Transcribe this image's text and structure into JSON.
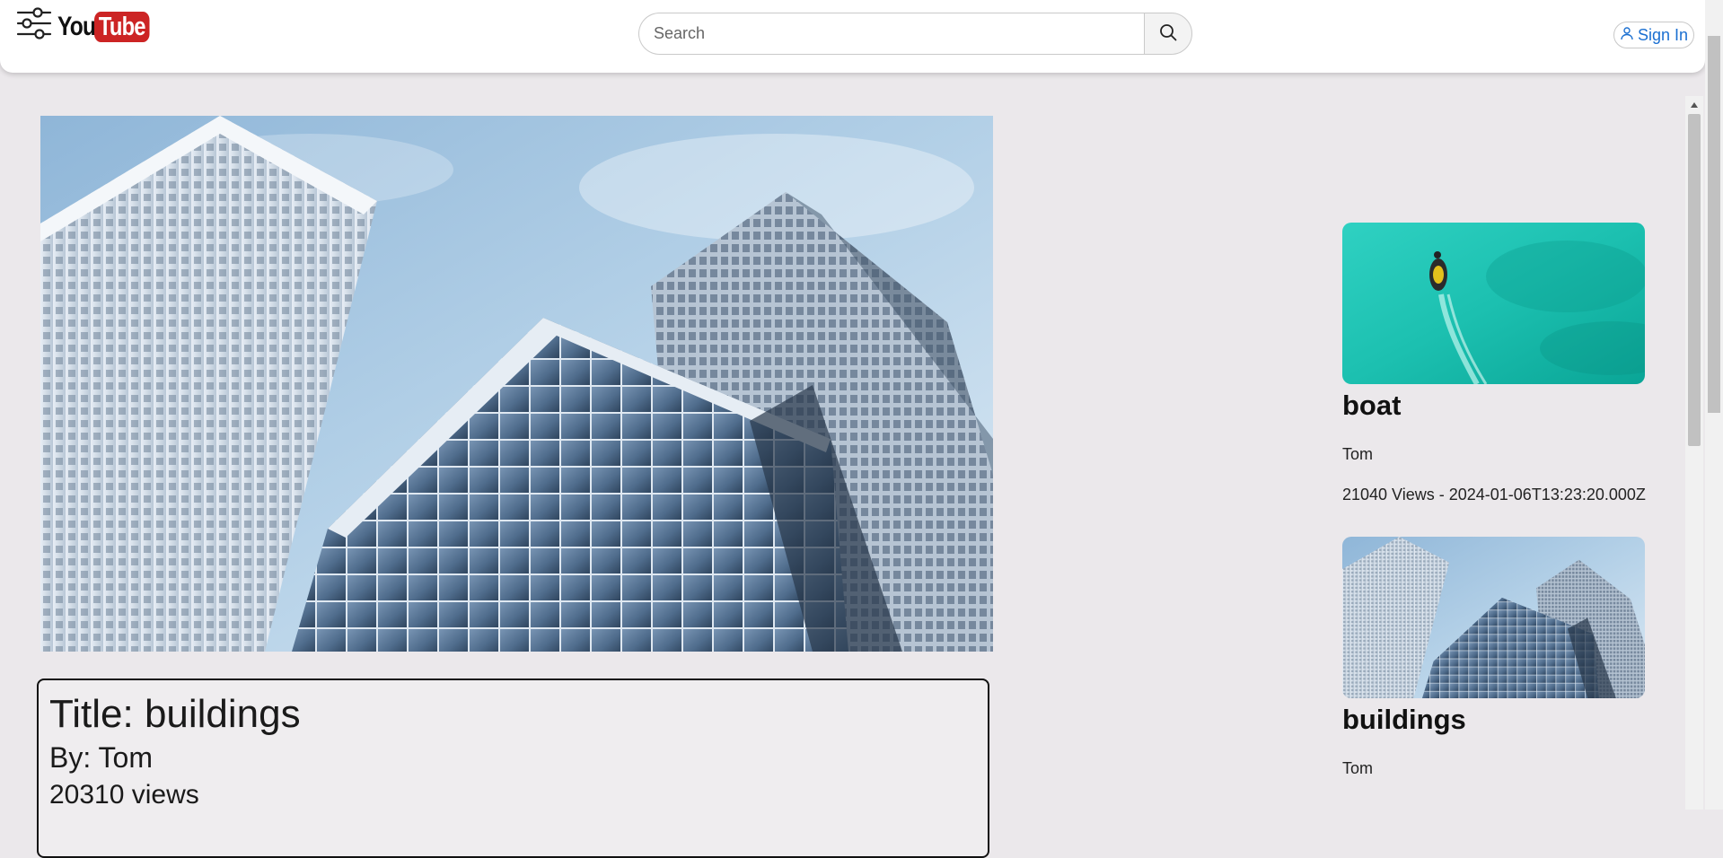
{
  "header": {
    "logo_you": "You",
    "logo_tube": "Tube",
    "search_placeholder": "Search",
    "signin_label": "Sign In"
  },
  "video": {
    "title": "Title: buildings",
    "author": "By: Tom",
    "views": "20310 views"
  },
  "recommendations": [
    {
      "title": "boat",
      "author": "Tom",
      "meta": "21040 Views - 2024-01-06T13:23:20.000Z"
    },
    {
      "title": "buildings",
      "author": "Tom",
      "meta": ""
    }
  ],
  "colors": {
    "accent": "#1a6fd1",
    "logo_red": "#cc2424",
    "page_bg": "#ebe8eb"
  },
  "icons": {
    "menu": "sliders-icon",
    "search": "search-icon",
    "user": "user-icon"
  }
}
